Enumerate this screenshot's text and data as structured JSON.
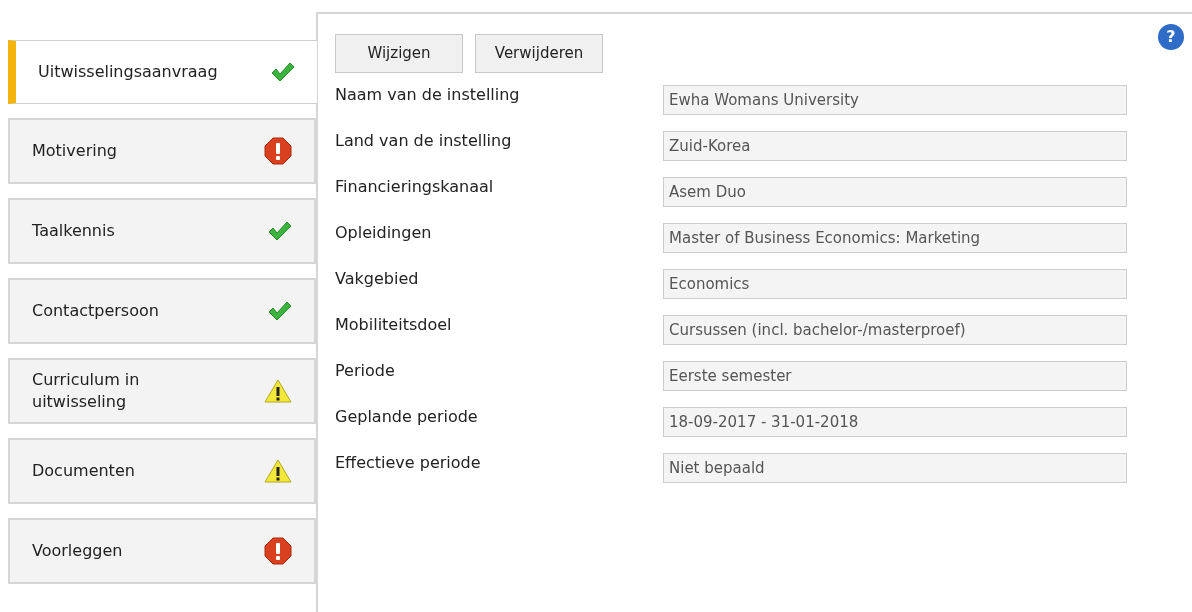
{
  "sidebar": {
    "items": [
      {
        "label": "Uitwisselingsaanvraag",
        "kind": "ok",
        "selected": true
      },
      {
        "label": "Motivering",
        "kind": "error",
        "selected": false
      },
      {
        "label": "Taalkennis",
        "kind": "ok",
        "selected": false
      },
      {
        "label": "Contactpersoon",
        "kind": "ok",
        "selected": false
      },
      {
        "label": "Curriculum in uitwisseling",
        "kind": "warning",
        "selected": false
      },
      {
        "label": "Documenten",
        "kind": "warning",
        "selected": false
      },
      {
        "label": "Voorleggen",
        "kind": "error",
        "selected": false
      }
    ]
  },
  "help": "?",
  "buttons": [
    "Wijzigen",
    "Verwijderen"
  ],
  "fields": [
    {
      "label": "Naam van de instelling",
      "value": "Ewha Womans University"
    },
    {
      "label": "Land van de instelling",
      "value": "Zuid-Korea"
    },
    {
      "label": "Financieringskanaal",
      "value": "Asem Duo"
    },
    {
      "label": "Opleidingen",
      "value": "Master of Business Economics: Marketing"
    },
    {
      "label": "Vakgebied",
      "value": "Economics"
    },
    {
      "label": "Mobiliteitsdoel",
      "value": "Cursussen (incl. bachelor-/masterproef)"
    },
    {
      "label": "Periode",
      "value": "Eerste semester"
    },
    {
      "label": "Geplande periode",
      "value": "18-09-2017 - 31-01-2018"
    },
    {
      "label": "Effectieve periode",
      "value": "Niet bepaald"
    }
  ]
}
